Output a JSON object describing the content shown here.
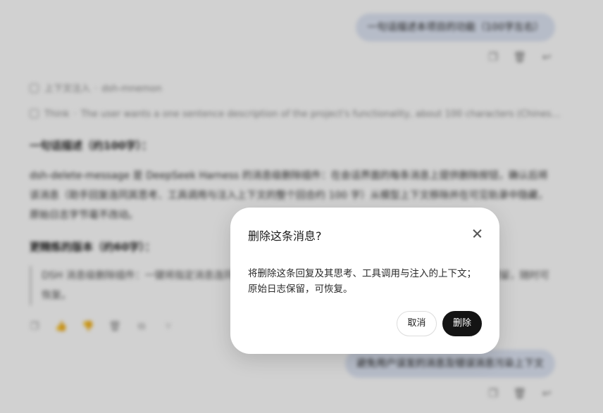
{
  "chat": {
    "user_messages": [
      {
        "text": "一句话描述本项目的功能（100字左右）"
      },
      {
        "text": "避免用户误发的消息及错误消息污染上下文"
      }
    ],
    "meta_context": {
      "label": "上下文注入",
      "value": "dsh-mnemon"
    },
    "meta_think": {
      "label": "Think",
      "value": "The user wants a one sentence description of the project's functionality, about 100 characters (Chinese). I al..."
    },
    "heading1": "一句话描述（约100字）：",
    "paragraph1": "dsh-delete-message 是 DeepSeek Harness 的消息级删除插件：在会话界面的每条消息上提供删除按钮，确认后将该消息（助手回复连同其思考、工具调用与注入上下文的整个回合约 100 字）从模型上下文移除并在可见轨录中隐藏，原始日志字节毫不改动。",
    "heading2": "更精炼的版本（约60字）：",
    "quote": "DSH 消息级删除插件：一键将指定消息连同思考、工具调用与注入上下文从模型上下文移除，原始日志保留，随时可恢复。"
  },
  "icons": {
    "copy": "copy-icon",
    "delete": "trash-icon",
    "reply": "reply-icon"
  },
  "modal": {
    "title": "删除这条消息?",
    "body": "将删除这条回复及其思考、工具调用与注入的上下文；原始日志保留，可恢复。",
    "cancel_label": "取消",
    "delete_label": "删除"
  }
}
